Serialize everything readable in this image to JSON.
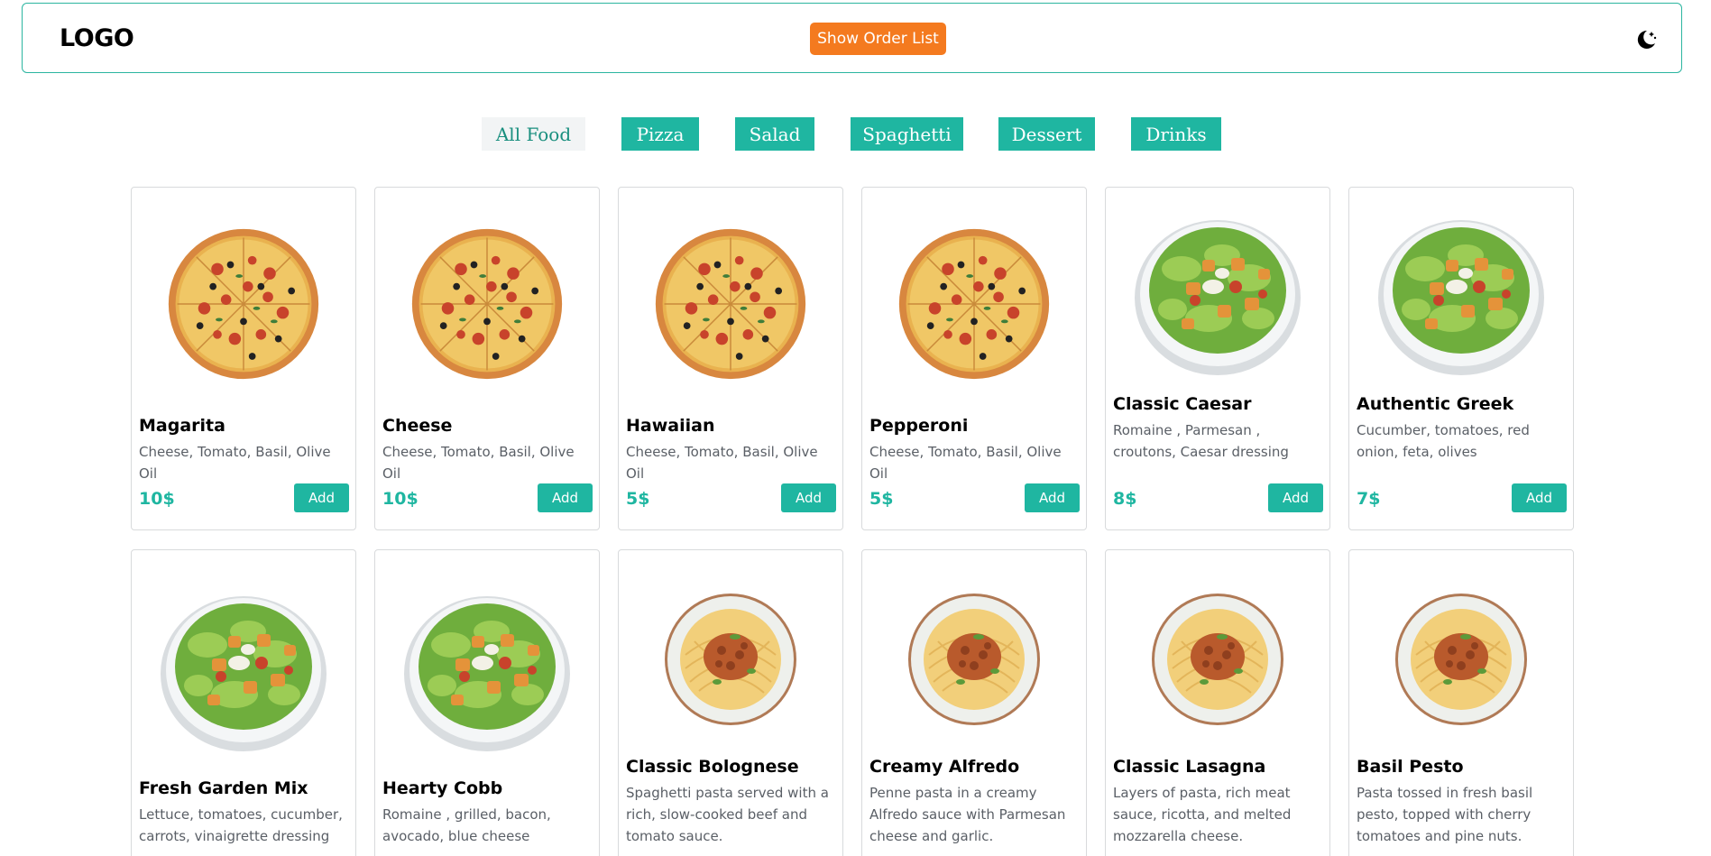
{
  "header": {
    "logo": "LOGO",
    "order_button": "Show Order List",
    "theme_icon": "moon-stars-icon"
  },
  "colors": {
    "accent": "#1fb6a1",
    "order_button": "#f47a1f",
    "header_border": "#2bb5a0"
  },
  "filters": [
    {
      "label": "All Food",
      "active": true
    },
    {
      "label": "Pizza",
      "active": false
    },
    {
      "label": "Salad",
      "active": false
    },
    {
      "label": "Spaghetti",
      "active": false
    },
    {
      "label": "Dessert",
      "active": false
    },
    {
      "label": "Drinks",
      "active": false
    }
  ],
  "cards": [
    {
      "name": "Magarita",
      "desc": "Cheese, Tomato, Basil, Olive Oil",
      "price": "10$",
      "add": "Add",
      "img": "pizza"
    },
    {
      "name": "Cheese",
      "desc": "Cheese, Tomato, Basil, Olive Oil",
      "price": "10$",
      "add": "Add",
      "img": "pizza"
    },
    {
      "name": "Hawaiian",
      "desc": "Cheese, Tomato, Basil, Olive Oil",
      "price": "5$",
      "add": "Add",
      "img": "pizza"
    },
    {
      "name": "Pepperoni",
      "desc": "Cheese, Tomato, Basil, Olive Oil",
      "price": "5$",
      "add": "Add",
      "img": "pizza"
    },
    {
      "name": "Classic Caesar",
      "desc": "Romaine , Parmesan , croutons, Caesar dressing",
      "price": "8$",
      "add": "Add",
      "img": "salad"
    },
    {
      "name": "Authentic Greek",
      "desc": "Cucumber, tomatoes, red onion, feta, olives",
      "price": "7$",
      "add": "Add",
      "img": "salad"
    },
    {
      "name": "Fresh Garden Mix",
      "desc": "Lettuce, tomatoes, cucumber, carrots, vinaigrette dressing",
      "img": "salad"
    },
    {
      "name": "Hearty Cobb",
      "desc": "Romaine , grilled, bacon, avocado, blue cheese",
      "img": "salad"
    },
    {
      "name": "Classic Bolognese",
      "desc": "Spaghetti pasta served with a rich, slow-cooked beef and tomato sauce.",
      "img": "pasta"
    },
    {
      "name": "Creamy Alfredo",
      "desc": "Penne pasta in a creamy Alfredo sauce with Parmesan cheese and garlic.",
      "img": "pasta"
    },
    {
      "name": "Classic Lasagna",
      "desc": "Layers of pasta, rich meat sauce, ricotta, and melted mozzarella cheese.",
      "img": "pasta"
    },
    {
      "name": "Basil Pesto",
      "desc": "Pasta tossed in fresh basil pesto, topped with cherry tomatoes and pine nuts.",
      "img": "pasta"
    }
  ]
}
